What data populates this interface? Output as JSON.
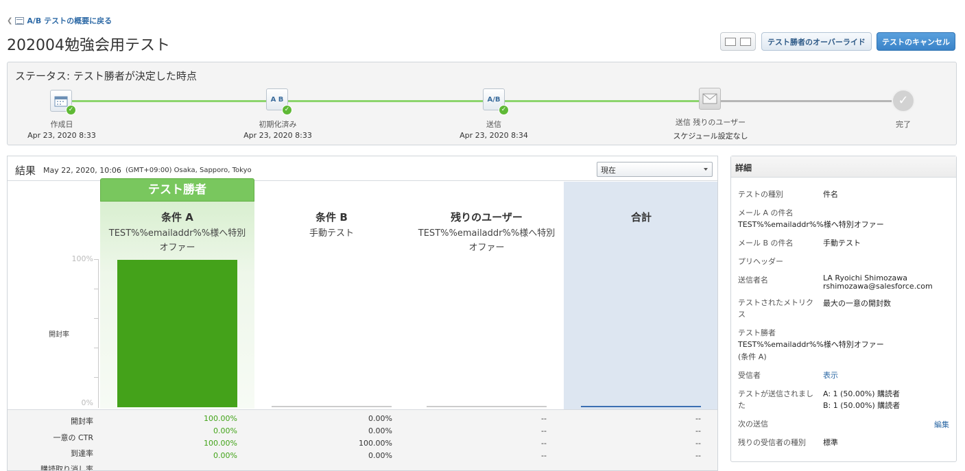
{
  "nav": {
    "back_label": "A/B テストの概要に戻る"
  },
  "page": {
    "title": "202004勉強会用テスト"
  },
  "toolbar": {
    "override_label": "テスト勝者のオーバーライド",
    "cancel_label": "テストのキャンセル"
  },
  "status": {
    "title": "ステータス: テスト勝者が決定した時点",
    "steps": [
      {
        "label": "作成日",
        "date": "Apr 23, 2020 8:33",
        "icon": "calendar-icon",
        "icon_text": ""
      },
      {
        "label": "初期化済み",
        "date": "Apr 23, 2020 8:33",
        "icon": "ab-split-icon",
        "icon_text": "A B"
      },
      {
        "label": "送信",
        "date": "Apr 23, 2020 8:34",
        "icon": "ab-send-icon",
        "icon_text": "A/B"
      },
      {
        "label": "送信 残りのユーザー",
        "date": "スケジュール設定なし",
        "icon": "envelope-icon",
        "icon_text": ""
      },
      {
        "label": "完了",
        "date": "",
        "icon": "check-circle-icon",
        "icon_text": ""
      }
    ],
    "progress_color": "#8cd46c"
  },
  "results": {
    "title": "結果",
    "date": "May 22, 2020, 10:06",
    "timezone": "(GMT+09:00) Osaka, Sapporo, Tokyo",
    "select_value": "現在",
    "winner_banner": "テスト勝者",
    "columns": [
      {
        "name": "条件 A",
        "subject": "TEST%%emailaddr%%様へ特別オファー"
      },
      {
        "name": "条件 B",
        "subject": "手動テスト"
      },
      {
        "name": "残りのユーザー",
        "subject": "TEST%%emailaddr%%様へ特別オファー"
      },
      {
        "name": "合計",
        "subject": ""
      }
    ],
    "y_max_label": "100%",
    "y_min_label": "0%",
    "y_axis_label": "開封率",
    "bar_values": [
      100,
      0,
      0,
      0
    ],
    "bar_colors": [
      "#44a21a",
      "#cccccc",
      "#cccccc",
      "#3b6fb2"
    ],
    "metrics": [
      {
        "label": "開封率",
        "values": [
          "100.00%",
          "0.00%",
          "--",
          "--"
        ]
      },
      {
        "label": "一意の CTR",
        "values": [
          "0.00%",
          "0.00%",
          "--",
          "--"
        ]
      },
      {
        "label": "到達率",
        "values": [
          "100.00%",
          "100.00%",
          "--",
          "--"
        ]
      },
      {
        "label": "購読取り消し率",
        "values": [
          "0.00%",
          "0.00%",
          "--",
          "--"
        ]
      }
    ]
  },
  "details": {
    "title": "詳細",
    "test_type_label": "テストの種別",
    "test_type_value": "件名",
    "subject_a_label": "メール A の件名",
    "subject_a_value": "TEST%%emailaddr%%様へ特別オファー",
    "subject_b_label": "メール B の件名",
    "subject_b_value": "手動テスト",
    "preheader_label": "プリヘッダー",
    "from_label": "送信者名",
    "from_name": "LA Ryoichi Shimozawa",
    "from_email": "rshimozawa@salesforce.com",
    "metric_label_1": "テストされたメトリク",
    "metric_label_2": "ス",
    "metric_value": "最大の一意の開封数",
    "winner_label": "テスト勝者",
    "winner_value": "TEST%%emailaddr%%様へ特別オファー",
    "winner_cond": "(条件 A)",
    "recipients_label": "受信者",
    "recipients_link": "表示",
    "sent_label_1": "テストが送信されまし",
    "sent_label_2": "た",
    "sent_a": "A: 1 (50.00%) 購読者",
    "sent_b": "B: 1 (50.00%) 購読者",
    "next_send_label": "次の送信",
    "next_send_link": "編集",
    "remaining_type_label": "残りの受信者の種別",
    "remaining_type_value": "標準"
  }
}
